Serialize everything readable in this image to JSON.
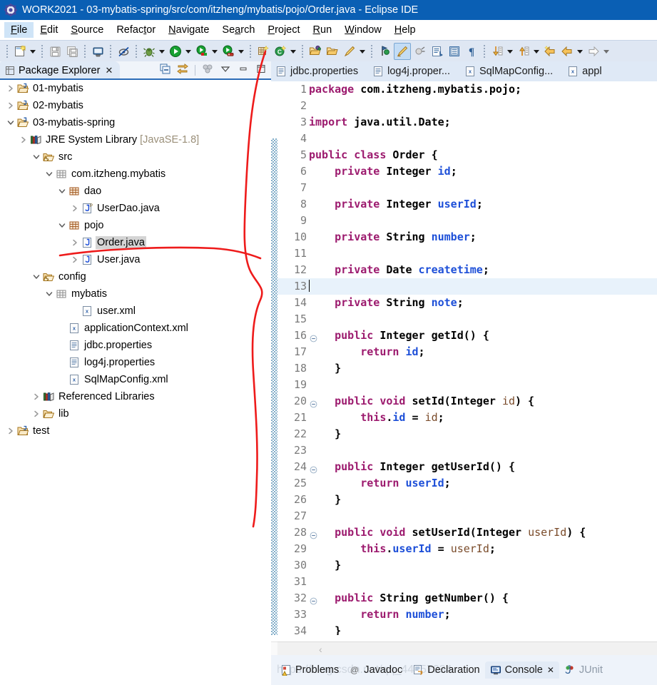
{
  "window": {
    "title": "WORK2021 - 03-mybatis-spring/src/com/itzheng/mybatis/pojo/Order.java - Eclipse IDE",
    "app_icon": "eclipse-icon",
    "titlebar_color": "#0a5fb4"
  },
  "menubar": {
    "items": [
      {
        "label": "File",
        "mnemonic": "F",
        "active": true
      },
      {
        "label": "Edit",
        "mnemonic": "E",
        "active": false
      },
      {
        "label": "Source",
        "mnemonic": "S",
        "active": false
      },
      {
        "label": "Refactor",
        "mnemonic": "t",
        "active": false
      },
      {
        "label": "Navigate",
        "mnemonic": "N",
        "active": false
      },
      {
        "label": "Search",
        "mnemonic": "a",
        "active": false
      },
      {
        "label": "Project",
        "mnemonic": "P",
        "active": false
      },
      {
        "label": "Run",
        "mnemonic": "R",
        "active": false
      },
      {
        "label": "Window",
        "mnemonic": "W",
        "active": false
      },
      {
        "label": "Help",
        "mnemonic": "H",
        "active": false
      }
    ]
  },
  "toolbar": {
    "buttons": [
      {
        "name": "new-wizard-icon",
        "title": "New"
      },
      {
        "name": "save-icon",
        "title": "Save"
      },
      {
        "name": "save-all-icon",
        "title": "Save All"
      },
      {
        "name": "print-icon",
        "title": "Print"
      },
      {
        "name": "toggle-mark-occurrences-icon",
        "title": "Toggle Mark Occurrences"
      },
      {
        "name": "debug-icon",
        "title": "Debug"
      },
      {
        "name": "run-icon",
        "title": "Run"
      },
      {
        "name": "run-external-tools-icon",
        "title": "External Tools"
      },
      {
        "name": "run-coverage-icon",
        "title": "Coverage"
      },
      {
        "name": "new-java-package-icon",
        "title": "New Java Package"
      },
      {
        "name": "new-java-class-icon",
        "title": "New Java Class"
      },
      {
        "name": "open-type-icon",
        "title": "Open Type"
      },
      {
        "name": "open-task-icon",
        "title": "Open Task"
      },
      {
        "name": "quick-fix-icon",
        "title": "Quick Fix"
      },
      {
        "name": "search-icon",
        "title": "Search"
      },
      {
        "name": "highlight-icon",
        "title": "Toggle Highlight"
      },
      {
        "name": "link-icon",
        "title": "Link"
      },
      {
        "name": "next-annotation-icon",
        "title": "Next Annotation"
      },
      {
        "name": "show-whitespace-icon",
        "title": "Show Whitespace"
      },
      {
        "name": "pilcrow-icon",
        "title": "Show Paragraph Marks"
      },
      {
        "name": "next-edit-icon",
        "title": "Next Edit Location"
      },
      {
        "name": "previous-edit-icon",
        "title": "Previous Edit Location"
      },
      {
        "name": "back-icon",
        "title": "Back"
      },
      {
        "name": "back-history-icon",
        "title": "Back History"
      },
      {
        "name": "forward-icon",
        "title": "Forward"
      }
    ]
  },
  "package_explorer": {
    "tab_label": "Package Explorer",
    "tab_icon": "package-explorer-icon",
    "close_glyph": "✕",
    "view_tools": [
      {
        "name": "collapse-all-icon",
        "title": "Collapse All"
      },
      {
        "name": "link-with-editor-icon",
        "title": "Link with Editor"
      },
      {
        "name": "view-menu-dots-icon",
        "title": "View Menu"
      },
      {
        "name": "view-menu-icon",
        "title": "View Menu"
      },
      {
        "name": "minimize-icon",
        "title": "Minimize"
      },
      {
        "name": "maximize-icon",
        "title": "Maximize"
      }
    ],
    "tree": [
      {
        "label": "01-mybatis",
        "indent": 0,
        "twisty": "collapsed",
        "icon": "java-project-closed-icon",
        "selected": false
      },
      {
        "label": "02-mybatis",
        "indent": 0,
        "twisty": "collapsed",
        "icon": "java-project-closed-icon",
        "selected": false
      },
      {
        "label": "03-mybatis-spring",
        "indent": 0,
        "twisty": "expanded",
        "icon": "java-project-open-icon",
        "selected": false
      },
      {
        "label": "JRE System Library",
        "suffix": " [JavaSE-1.8]",
        "indent": 1,
        "twisty": "collapsed",
        "icon": "library-icon",
        "selected": false
      },
      {
        "label": "src",
        "indent": 2,
        "twisty": "expanded",
        "icon": "source-folder-icon",
        "selected": false
      },
      {
        "label": "com.itzheng.mybatis",
        "indent": 3,
        "twisty": "expanded",
        "icon": "package-empty-icon",
        "selected": false
      },
      {
        "label": "dao",
        "indent": 4,
        "twisty": "expanded",
        "icon": "package-icon",
        "selected": false
      },
      {
        "label": "UserDao.java",
        "indent": 5,
        "twisty": "collapsed",
        "icon": "java-interface-file-icon",
        "selected": false
      },
      {
        "label": "pojo",
        "indent": 4,
        "twisty": "expanded",
        "icon": "package-icon",
        "selected": false
      },
      {
        "label": "Order.java",
        "indent": 5,
        "twisty": "collapsed",
        "icon": "java-file-icon",
        "selected": true
      },
      {
        "label": "User.java",
        "indent": 5,
        "twisty": "collapsed",
        "icon": "java-file-icon",
        "selected": false
      },
      {
        "label": "config",
        "indent": 2,
        "twisty": "expanded",
        "icon": "source-folder-icon",
        "selected": false
      },
      {
        "label": "mybatis",
        "indent": 3,
        "twisty": "expanded",
        "icon": "package-empty-icon",
        "selected": false
      },
      {
        "label": "user.xml",
        "indent": 5,
        "twisty": "none",
        "icon": "xml-file-icon",
        "selected": false
      },
      {
        "label": "applicationContext.xml",
        "indent": 4,
        "twisty": "none",
        "icon": "xml-file-icon",
        "selected": false
      },
      {
        "label": "jdbc.properties",
        "indent": 4,
        "twisty": "none",
        "icon": "properties-file-icon",
        "selected": false
      },
      {
        "label": "log4j.properties",
        "indent": 4,
        "twisty": "none",
        "icon": "properties-file-icon",
        "selected": false
      },
      {
        "label": "SqlMapConfig.xml",
        "indent": 4,
        "twisty": "none",
        "icon": "xml-file-icon",
        "selected": false
      },
      {
        "label": "Referenced Libraries",
        "indent": 2,
        "twisty": "collapsed",
        "icon": "library-icon",
        "selected": false
      },
      {
        "label": "lib",
        "indent": 2,
        "twisty": "collapsed",
        "icon": "folder-icon",
        "selected": false
      },
      {
        "label": "test",
        "indent": 0,
        "twisty": "collapsed",
        "icon": "java-project-closed-icon",
        "selected": false
      }
    ]
  },
  "editor": {
    "tabs": [
      {
        "label": "jdbc.properties",
        "icon": "properties-file-icon",
        "active": false
      },
      {
        "label": "log4j.proper...",
        "icon": "properties-file-icon",
        "active": false
      },
      {
        "label": "SqlMapConfig...",
        "icon": "xml-file-icon",
        "active": false
      },
      {
        "label": "appl",
        "icon": "xml-file-icon",
        "active": false
      }
    ],
    "current_line": 13,
    "first_visible_line": 1,
    "scroll_left_chevron": "‹",
    "lines": [
      {
        "n": 1,
        "fold": false,
        "tokens": [
          {
            "t": "package ",
            "c": "kw"
          },
          {
            "t": "com.itzheng.mybatis.pojo;",
            "c": "plain"
          }
        ]
      },
      {
        "n": 2,
        "fold": false,
        "tokens": []
      },
      {
        "n": 3,
        "fold": false,
        "tokens": [
          {
            "t": "import ",
            "c": "kw"
          },
          {
            "t": "java.util.Date;",
            "c": "plain"
          }
        ]
      },
      {
        "n": 4,
        "fold": false,
        "tokens": []
      },
      {
        "n": 5,
        "fold": false,
        "tokens": [
          {
            "t": "public class ",
            "c": "kw"
          },
          {
            "t": "Order {",
            "c": "plain"
          }
        ]
      },
      {
        "n": 6,
        "fold": false,
        "tokens": [
          {
            "t": "    ",
            "c": "plain"
          },
          {
            "t": "private ",
            "c": "kw"
          },
          {
            "t": "Integer ",
            "c": "plain"
          },
          {
            "t": "id",
            "c": "fld"
          },
          {
            "t": ";",
            "c": "plain"
          }
        ]
      },
      {
        "n": 7,
        "fold": false,
        "tokens": []
      },
      {
        "n": 8,
        "fold": false,
        "tokens": [
          {
            "t": "    ",
            "c": "plain"
          },
          {
            "t": "private ",
            "c": "kw"
          },
          {
            "t": "Integer ",
            "c": "plain"
          },
          {
            "t": "userId",
            "c": "fld"
          },
          {
            "t": ";",
            "c": "plain"
          }
        ]
      },
      {
        "n": 9,
        "fold": false,
        "tokens": []
      },
      {
        "n": 10,
        "fold": false,
        "tokens": [
          {
            "t": "    ",
            "c": "plain"
          },
          {
            "t": "private ",
            "c": "kw"
          },
          {
            "t": "String ",
            "c": "plain"
          },
          {
            "t": "number",
            "c": "fld"
          },
          {
            "t": ";",
            "c": "plain"
          }
        ]
      },
      {
        "n": 11,
        "fold": false,
        "tokens": []
      },
      {
        "n": 12,
        "fold": false,
        "tokens": [
          {
            "t": "    ",
            "c": "plain"
          },
          {
            "t": "private ",
            "c": "kw"
          },
          {
            "t": "Date ",
            "c": "plain"
          },
          {
            "t": "createtime",
            "c": "fld"
          },
          {
            "t": ";",
            "c": "plain"
          }
        ]
      },
      {
        "n": 13,
        "fold": false,
        "tokens": []
      },
      {
        "n": 14,
        "fold": false,
        "tokens": [
          {
            "t": "    ",
            "c": "plain"
          },
          {
            "t": "private ",
            "c": "kw"
          },
          {
            "t": "String ",
            "c": "plain"
          },
          {
            "t": "note",
            "c": "fld"
          },
          {
            "t": ";",
            "c": "plain"
          }
        ]
      },
      {
        "n": 15,
        "fold": false,
        "tokens": []
      },
      {
        "n": 16,
        "fold": true,
        "tokens": [
          {
            "t": "    ",
            "c": "plain"
          },
          {
            "t": "public ",
            "c": "kw"
          },
          {
            "t": "Integer getId() {",
            "c": "plain"
          }
        ]
      },
      {
        "n": 17,
        "fold": false,
        "tokens": [
          {
            "t": "        ",
            "c": "plain"
          },
          {
            "t": "return ",
            "c": "kw"
          },
          {
            "t": "id",
            "c": "fld"
          },
          {
            "t": ";",
            "c": "plain"
          }
        ]
      },
      {
        "n": 18,
        "fold": false,
        "tokens": [
          {
            "t": "    }",
            "c": "plain"
          }
        ]
      },
      {
        "n": 19,
        "fold": false,
        "tokens": []
      },
      {
        "n": 20,
        "fold": true,
        "tokens": [
          {
            "t": "    ",
            "c": "plain"
          },
          {
            "t": "public void ",
            "c": "kw"
          },
          {
            "t": "setId(Integer ",
            "c": "plain"
          },
          {
            "t": "id",
            "c": "prm"
          },
          {
            "t": ") {",
            "c": "plain"
          }
        ]
      },
      {
        "n": 21,
        "fold": false,
        "tokens": [
          {
            "t": "        ",
            "c": "plain"
          },
          {
            "t": "this",
            "c": "kw"
          },
          {
            "t": ".",
            "c": "plain"
          },
          {
            "t": "id",
            "c": "fld"
          },
          {
            "t": " = ",
            "c": "plain"
          },
          {
            "t": "id",
            "c": "prm"
          },
          {
            "t": ";",
            "c": "plain"
          }
        ]
      },
      {
        "n": 22,
        "fold": false,
        "tokens": [
          {
            "t": "    }",
            "c": "plain"
          }
        ]
      },
      {
        "n": 23,
        "fold": false,
        "tokens": []
      },
      {
        "n": 24,
        "fold": true,
        "tokens": [
          {
            "t": "    ",
            "c": "plain"
          },
          {
            "t": "public ",
            "c": "kw"
          },
          {
            "t": "Integer getUserId() {",
            "c": "plain"
          }
        ]
      },
      {
        "n": 25,
        "fold": false,
        "tokens": [
          {
            "t": "        ",
            "c": "plain"
          },
          {
            "t": "return ",
            "c": "kw"
          },
          {
            "t": "userId",
            "c": "fld"
          },
          {
            "t": ";",
            "c": "plain"
          }
        ]
      },
      {
        "n": 26,
        "fold": false,
        "tokens": [
          {
            "t": "    }",
            "c": "plain"
          }
        ]
      },
      {
        "n": 27,
        "fold": false,
        "tokens": []
      },
      {
        "n": 28,
        "fold": true,
        "tokens": [
          {
            "t": "    ",
            "c": "plain"
          },
          {
            "t": "public void ",
            "c": "kw"
          },
          {
            "t": "setUserId(Integer ",
            "c": "plain"
          },
          {
            "t": "userId",
            "c": "prm"
          },
          {
            "t": ") {",
            "c": "plain"
          }
        ]
      },
      {
        "n": 29,
        "fold": false,
        "tokens": [
          {
            "t": "        ",
            "c": "plain"
          },
          {
            "t": "this",
            "c": "kw"
          },
          {
            "t": ".",
            "c": "plain"
          },
          {
            "t": "userId",
            "c": "fld"
          },
          {
            "t": " = ",
            "c": "plain"
          },
          {
            "t": "userId",
            "c": "prm"
          },
          {
            "t": ";",
            "c": "plain"
          }
        ]
      },
      {
        "n": 30,
        "fold": false,
        "tokens": [
          {
            "t": "    }",
            "c": "plain"
          }
        ]
      },
      {
        "n": 31,
        "fold": false,
        "tokens": []
      },
      {
        "n": 32,
        "fold": true,
        "tokens": [
          {
            "t": "    ",
            "c": "plain"
          },
          {
            "t": "public ",
            "c": "kw"
          },
          {
            "t": "String getNumber() {",
            "c": "plain"
          }
        ]
      },
      {
        "n": 33,
        "fold": false,
        "tokens": [
          {
            "t": "        ",
            "c": "plain"
          },
          {
            "t": "return ",
            "c": "kw"
          },
          {
            "t": "number",
            "c": "fld"
          },
          {
            "t": ";",
            "c": "plain"
          }
        ]
      },
      {
        "n": 34,
        "fold": false,
        "tokens": [
          {
            "t": "    }",
            "c": "plain"
          }
        ]
      }
    ]
  },
  "bottom_panel": {
    "tabs": [
      {
        "label": "Problems",
        "icon": "problems-icon",
        "active": false
      },
      {
        "label": "Javadoc",
        "icon": "javadoc-icon",
        "active": false
      },
      {
        "label": "Declaration",
        "icon": "declaration-icon",
        "active": false
      },
      {
        "label": "Console",
        "icon": "console-icon",
        "active": true,
        "close_glyph": "✕"
      },
      {
        "label": "JUnit",
        "icon": "junit-icon",
        "active": false
      }
    ],
    "watermark": "https://blog.csdn.net/qq_44757034"
  },
  "annotation": {
    "color": "#ee1b1b",
    "description": "red-handdrawn-curve"
  }
}
